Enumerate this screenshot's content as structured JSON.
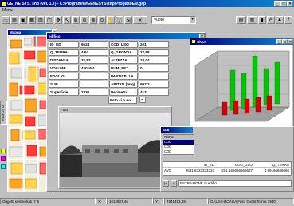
{
  "app": {
    "title": "GE_NE SYS. shp (vel. 1.7) - C:\\Programmi\\GENESYS\\shp\\ProgettoEw.gsp",
    "menu": [
      "Menu"
    ],
    "layer_select": "Vuoto"
  },
  "map": {
    "title": "Mappa",
    "side_tabs": [
      "RISPOSTA",
      "FOTO"
    ]
  },
  "form": {
    "title": "edifico",
    "fields": [
      {
        "label": "ID_ED",
        "value": "9524",
        "label2": "COD_USO",
        "value2": "201"
      },
      {
        "label": "Q_TERRA",
        "value": "4,64",
        "label2": "Q_GRONDA",
        "value2": "22,88"
      },
      {
        "label": "DISTANZA",
        "value": "32,83",
        "label2": "ALTEZZA",
        "value2": "18,04"
      },
      {
        "label": "VOLUME",
        "value": "42016,4",
        "label2": "NUM_SEZ",
        "value2": "0"
      },
      {
        "label": "FOGLIO",
        "value": "",
        "label2": "PARTICELLA",
        "value2": ""
      },
      {
        "label": "SUB",
        "value": "",
        "label2": "ABITATI (mtq)",
        "value2": "997,2"
      },
      {
        "label": "Superficie",
        "value": "2330",
        "label2": "Perimetro",
        "value2": "413"
      }
    ],
    "foto_label": "Foto si o no",
    "foto_checked": true,
    "foto_panel_title": "Foto"
  },
  "chart": {
    "title": "Chart",
    "colors": {
      "green": "#00c800",
      "red": "#d80000",
      "floor": "#a0a0a0",
      "wall": "#c0c0c0"
    }
  },
  "stats": {
    "title": "Stat",
    "header_label": "RisPos",
    "list_items": [
      "COD",
      "COD",
      "COD"
    ],
    "columns": [
      "ID_ED",
      "COD_USO",
      "Q_TERRA"
    ],
    "row_label": "AVG",
    "values": [
      "9531,6333333333",
      "201,166666666667",
      "4,59166666666"
    ],
    "footer": "ESTRAZIONE di edifici"
  },
  "statusbar": {
    "selected": "Oggetti selezionati nº 6",
    "x_label": "X:",
    "x_value": "1612807,46",
    "y_label": "Y:",
    "y_value": "4941493,49",
    "projection": "GAUSS-BOAGA Fuso Ovest Roma 1940"
  }
}
